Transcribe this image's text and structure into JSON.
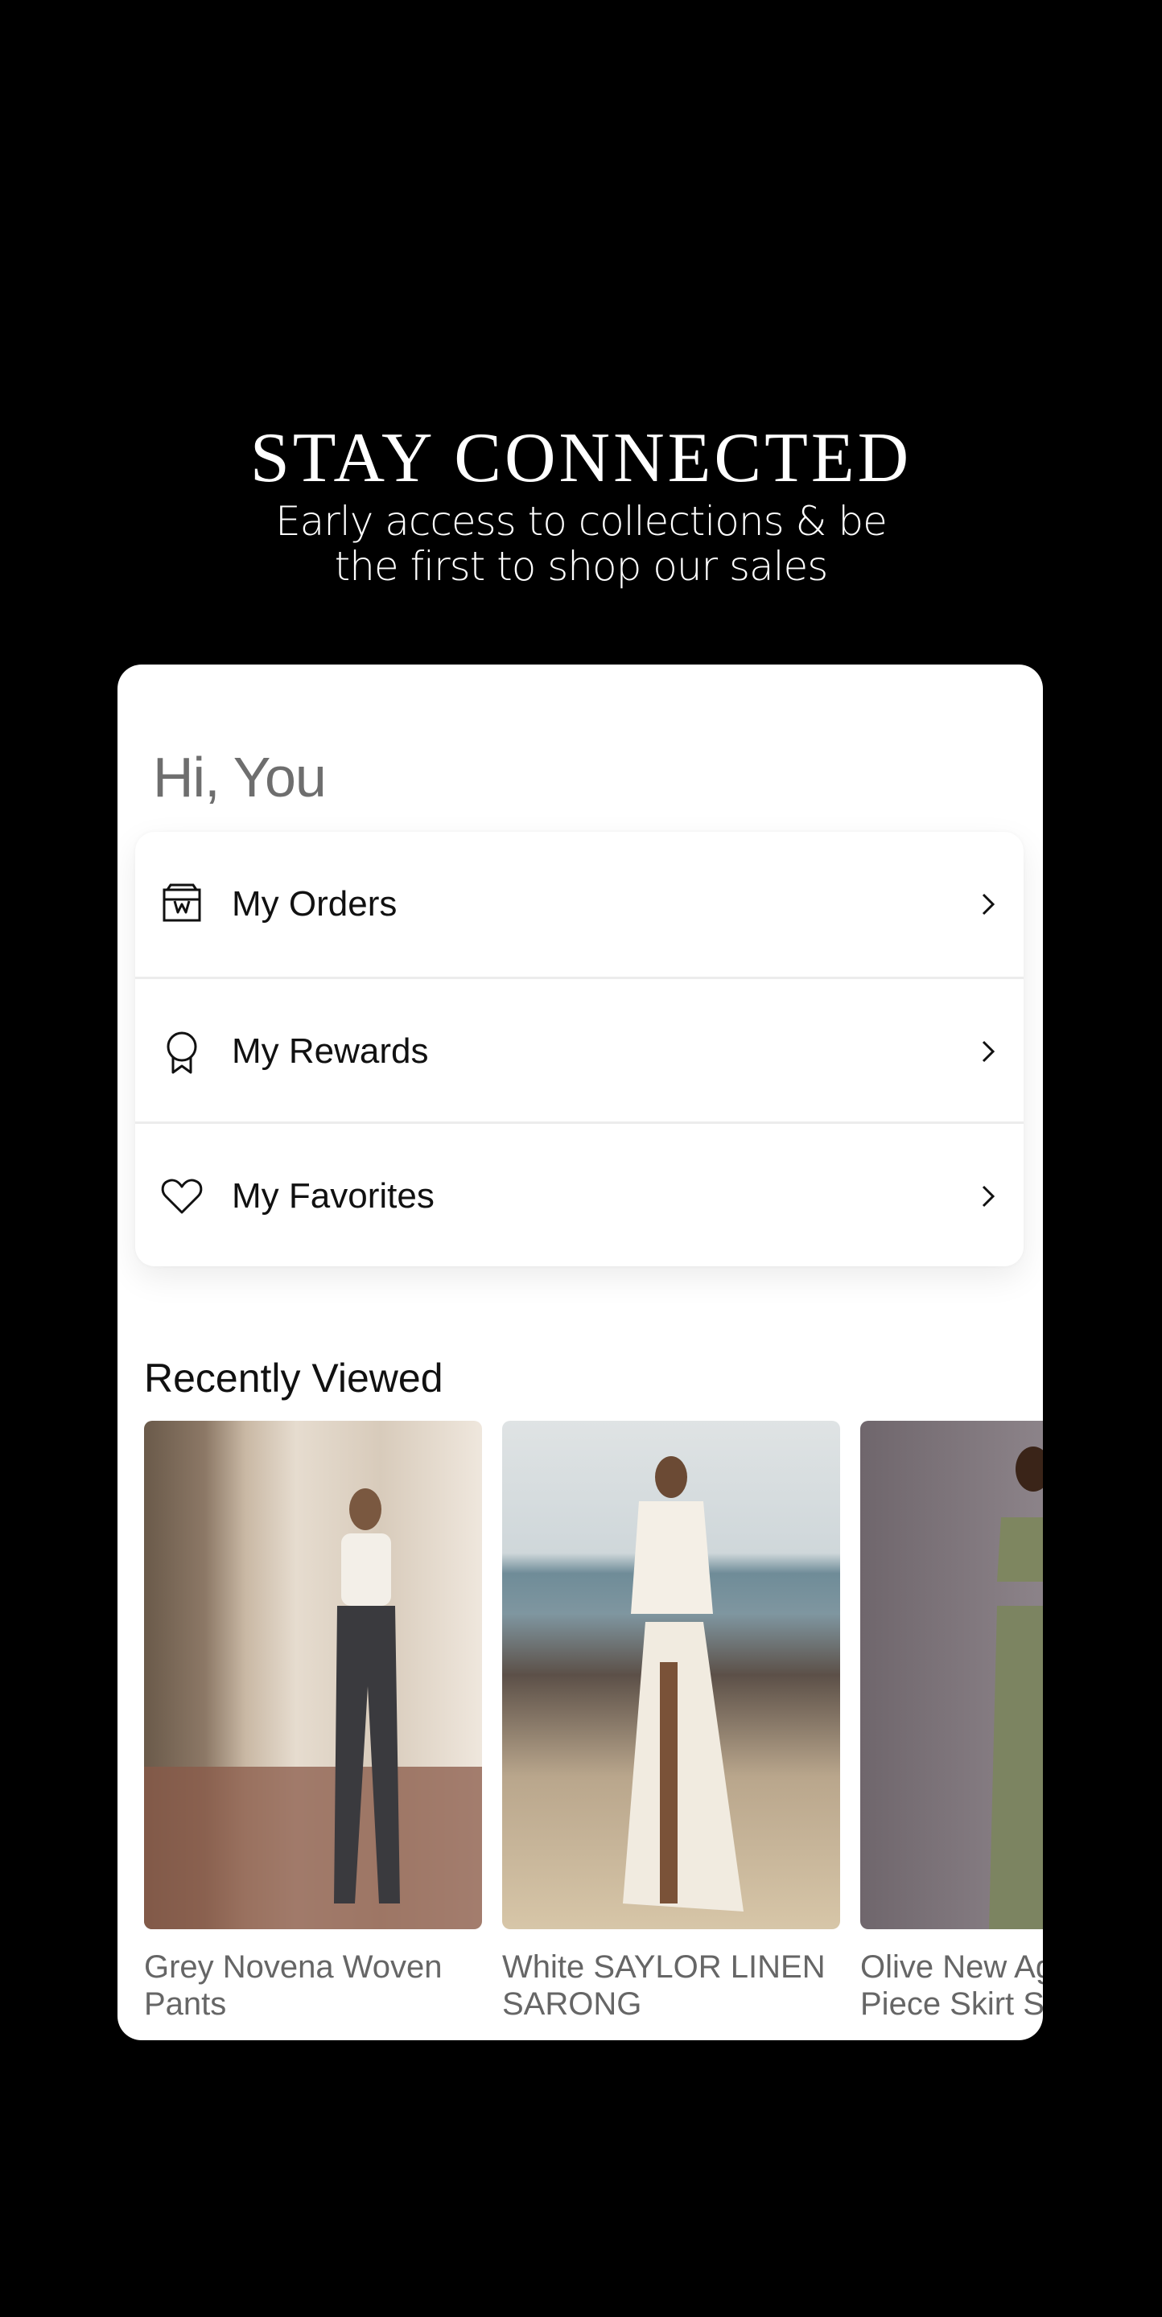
{
  "hero": {
    "title": "STAY CONNECTED",
    "subtitle_line1": "Early access to collections & be",
    "subtitle_line2": "the first to shop our sales"
  },
  "account": {
    "greeting": "Hi, You",
    "menu": [
      {
        "label": "My Orders",
        "icon": "orders-box-icon"
      },
      {
        "label": "My Rewards",
        "icon": "rewards-ribbon-icon"
      },
      {
        "label": "My Favorites",
        "icon": "heart-icon"
      }
    ]
  },
  "recently_viewed": {
    "title": "Recently Viewed",
    "products": [
      {
        "name_line1": "Grey Novena Woven",
        "name_line2": "Pants"
      },
      {
        "name_line1": "White SAYLOR LINEN",
        "name_line2": "SARONG"
      },
      {
        "name_line1": "Olive New Ag",
        "name_line2": "Piece Skirt S"
      }
    ]
  },
  "colors": {
    "background": "#000000",
    "card": "#ffffff",
    "text_dark": "#111111",
    "text_muted": "#666666"
  }
}
